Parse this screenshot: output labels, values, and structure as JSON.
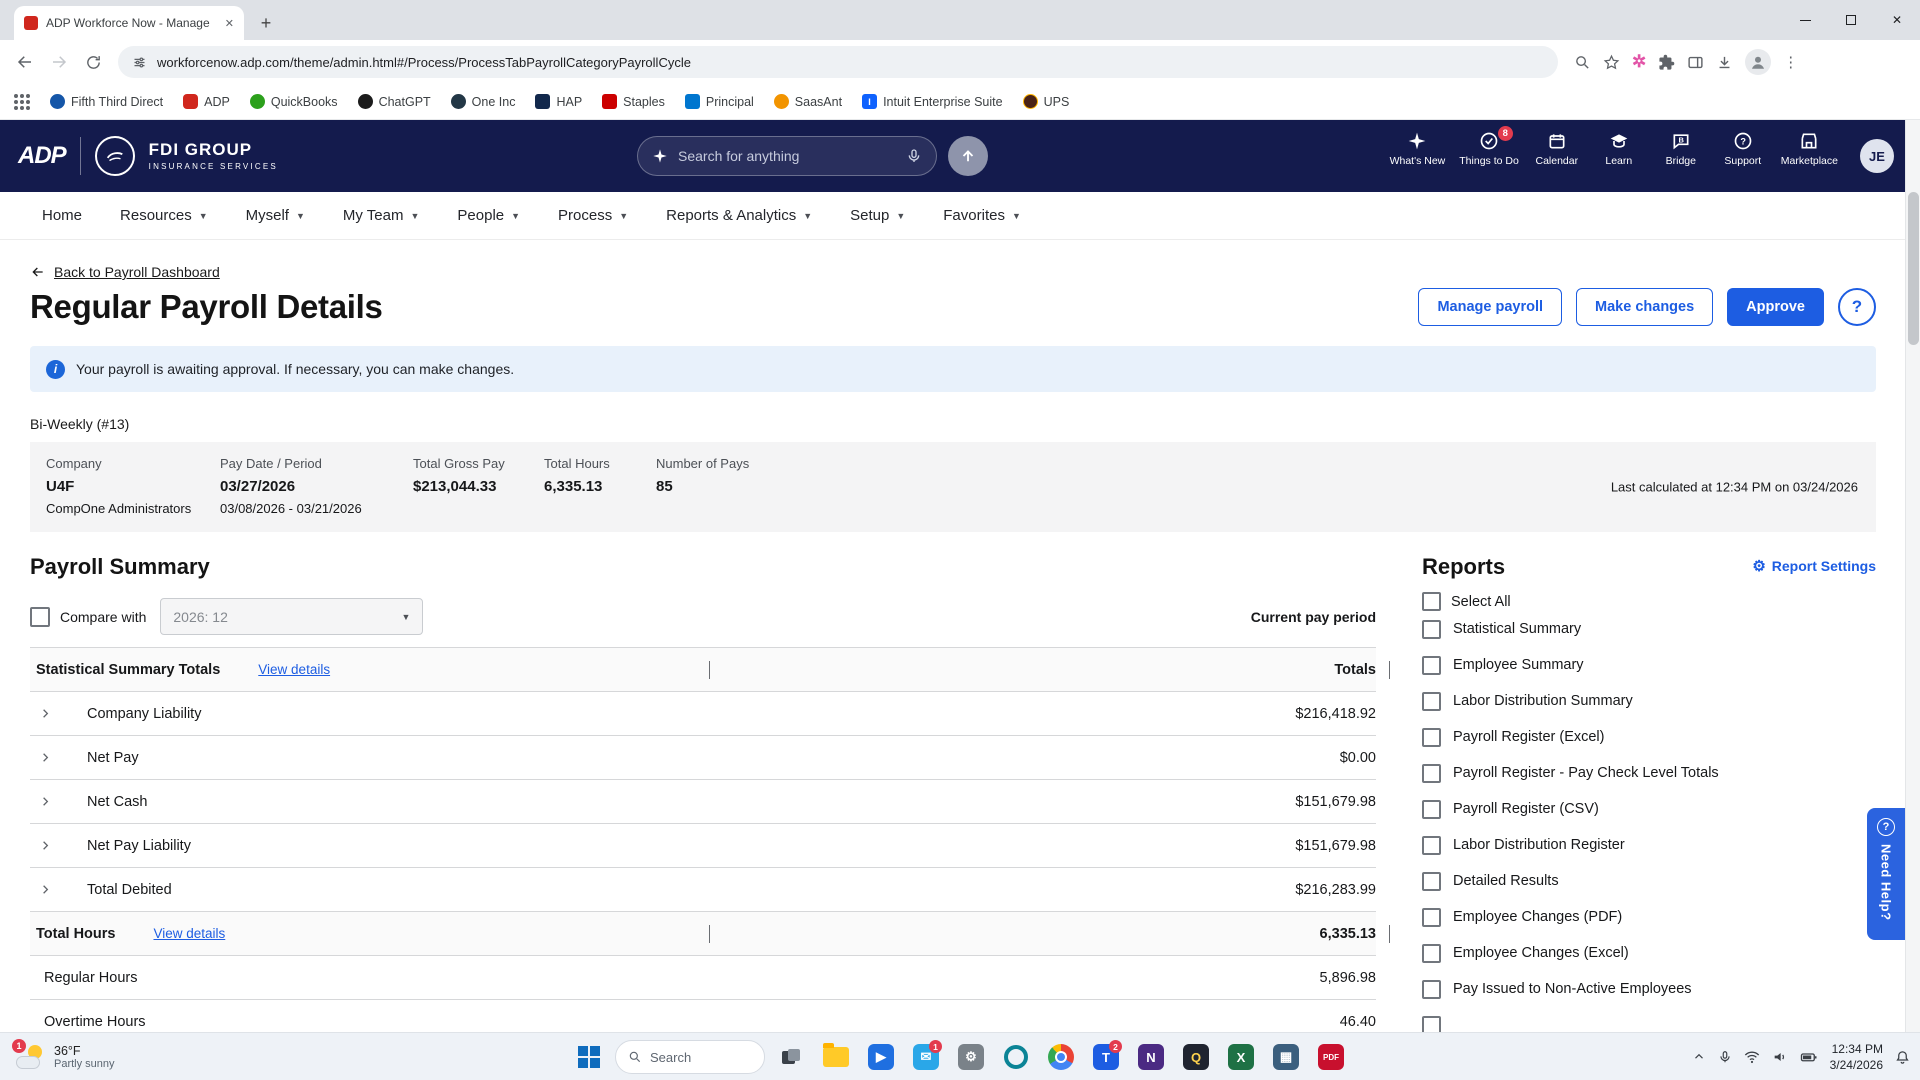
{
  "browser": {
    "tab_title": "ADP Workforce Now - Manage",
    "url": "workforcenow.adp.com/theme/admin.html#/Process/ProcessTabPayrollCategoryPayrollCycle",
    "bookmarks": [
      {
        "label": "Fifth Third Direct"
      },
      {
        "label": "ADP"
      },
      {
        "label": "QuickBooks"
      },
      {
        "label": "ChatGPT"
      },
      {
        "label": "One Inc"
      },
      {
        "label": "HAP"
      },
      {
        "label": "Staples"
      },
      {
        "label": "Principal"
      },
      {
        "label": "SaasAnt"
      },
      {
        "label": "Intuit Enterprise Suite"
      },
      {
        "label": "UPS"
      }
    ]
  },
  "header": {
    "logo": "ADP",
    "brand_name": "FDI GROUP",
    "brand_tagline": "INSURANCE SERVICES",
    "search_placeholder": "Search for anything",
    "icons": [
      {
        "label": "What's New"
      },
      {
        "label": "Things to Do",
        "badge": "8"
      },
      {
        "label": "Calendar"
      },
      {
        "label": "Learn"
      },
      {
        "label": "Bridge"
      },
      {
        "label": "Support"
      },
      {
        "label": "Marketplace"
      }
    ],
    "avatar": "JE"
  },
  "nav": {
    "items": [
      {
        "label": "Home"
      },
      {
        "label": "Resources"
      },
      {
        "label": "Myself"
      },
      {
        "label": "My Team"
      },
      {
        "label": "People"
      },
      {
        "label": "Process"
      },
      {
        "label": "Reports & Analytics"
      },
      {
        "label": "Setup"
      },
      {
        "label": "Favorites"
      }
    ]
  },
  "page": {
    "back_link": "Back to Payroll Dashboard",
    "title": "Regular Payroll Details",
    "buttons": {
      "manage": "Manage payroll",
      "make_changes": "Make changes",
      "approve": "Approve"
    },
    "banner": "Your payroll is awaiting approval. If necessary, you can make changes.",
    "cycle": "Bi-Weekly (#13)",
    "summary": {
      "company_label": "Company",
      "company": "U4F",
      "company_sub": "CompOne Administrators",
      "pay_label": "Pay Date / Period",
      "pay_date": "03/27/2026",
      "pay_period": "03/08/2026 - 03/21/2026",
      "gross_label": "Total Gross Pay",
      "gross": "$213,044.33",
      "hours_label": "Total Hours",
      "hours": "6,335.13",
      "pays_label": "Number of Pays",
      "pays": "85",
      "last_calculated": "Last calculated at 12:34 PM on 03/24/2026"
    }
  },
  "payroll_summary": {
    "title": "Payroll Summary",
    "compare_label": "Compare with",
    "compare_value": "2026: 12",
    "current_period": "Current pay period",
    "stat_header": {
      "label": "Statistical Summary Totals",
      "link": "View details",
      "totals": "Totals"
    },
    "rows": [
      {
        "label": "Company Liability",
        "value": "$216,418.92"
      },
      {
        "label": "Net Pay",
        "value": "$0.00"
      },
      {
        "label": "Net Cash",
        "value": "$151,679.98"
      },
      {
        "label": "Net Pay Liability",
        "value": "$151,679.98"
      },
      {
        "label": "Total Debited",
        "value": "$216,283.99"
      }
    ],
    "hours_header": {
      "label": "Total Hours",
      "link": "View details",
      "total": "6,335.13"
    },
    "hours_rows": [
      {
        "label": "Regular Hours",
        "value": "5,896.98"
      },
      {
        "label": "Overtime Hours",
        "value": "46.40"
      }
    ]
  },
  "reports": {
    "title": "Reports",
    "settings": "Report Settings",
    "select_all": "Select All",
    "items": [
      {
        "label": "Statistical Summary"
      },
      {
        "label": "Employee Summary"
      },
      {
        "label": "Labor Distribution Summary"
      },
      {
        "label": "Payroll Register (Excel)"
      },
      {
        "label": "Payroll Register - Pay Check Level Totals"
      },
      {
        "label": "Payroll Register (CSV)"
      },
      {
        "label": "Labor Distribution Register"
      },
      {
        "label": "Detailed Results"
      },
      {
        "label": "Employee Changes (PDF)"
      },
      {
        "label": "Employee Changes (Excel)"
      },
      {
        "label": "Pay Issued to Non-Active Employees"
      }
    ]
  },
  "need_help": "Need Help?",
  "taskbar": {
    "weather_temp": "36°F",
    "weather_desc": "Partly sunny",
    "weather_badge": "1",
    "search": "Search",
    "time": "12:34 PM",
    "date": "3/24/2026"
  },
  "colors": {
    "accent": "#1d5de2",
    "header_navy": "#141b4d",
    "banner_bg": "#e8f1fb"
  }
}
